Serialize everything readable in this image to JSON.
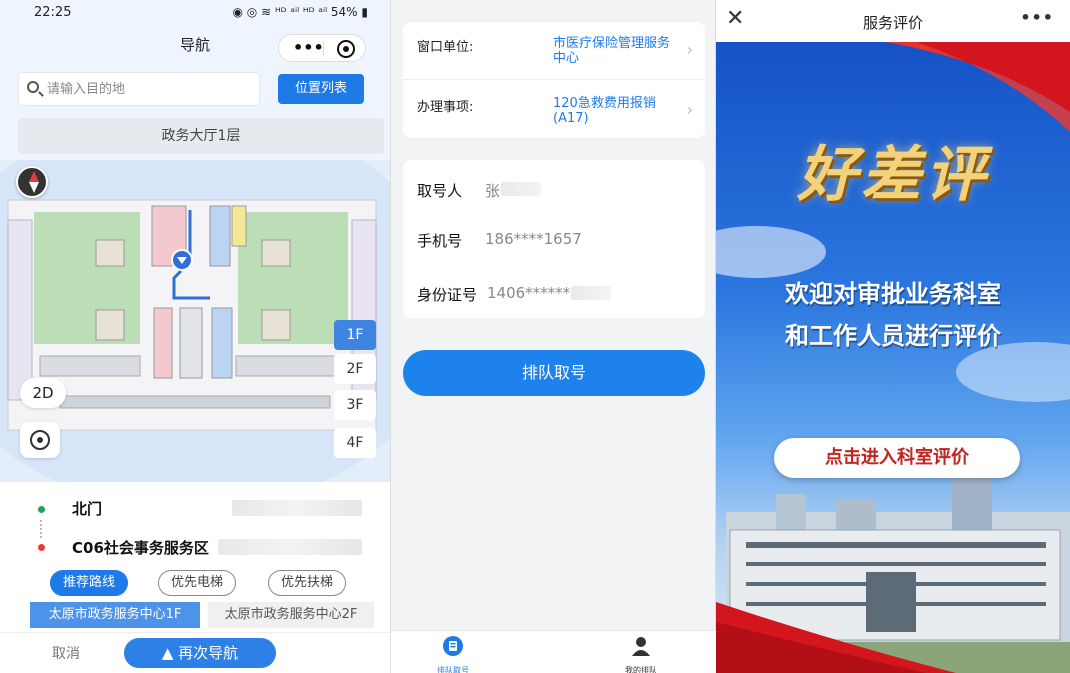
{
  "nav_panel": {
    "status": {
      "time": "22:25",
      "battery": "54%",
      "icons_text": "◉ ◎ ≋ ᴴᴰ ᵃⁱˡ ᴴᴰ ᵃⁱˡ"
    },
    "title": "导航",
    "search": {
      "placeholder": "请输入目的地"
    },
    "location_list_label": "位置列表",
    "floor_title": "政务大厅1层",
    "floors": [
      "1F",
      "2F",
      "3F",
      "4F"
    ],
    "active_floor": "1F",
    "mode_label": "2D",
    "route": {
      "start": "北门",
      "end": "C06社会事务服务区",
      "start_color": "#21a35b",
      "end_color": "#e43b3b"
    },
    "route_options": [
      "推荐路线",
      "优先电梯",
      "优先扶梯"
    ],
    "floor_tabs": [
      "太原市政务服务中心1F",
      "太原市政务服务中心2F"
    ],
    "cancel_label": "取消",
    "renavigate_label": "再次导航",
    "accent": "#1e7ae6"
  },
  "queue_panel": {
    "window_label": "窗口单位:",
    "window_value": "市医疗保险管理服务中心",
    "item_label": "办理事项:",
    "item_value": "120急救费用报销(A17)",
    "taker_label": "取号人",
    "taker_value": "张",
    "phone_label": "手机号",
    "phone_value": "186****1657",
    "id_label": "身份证号",
    "id_value": "1406******",
    "queue_button": "排队取号",
    "tabs": [
      {
        "label": "排队取号",
        "icon": "queue-ticket-icon",
        "active": true
      },
      {
        "label": "我的排队",
        "icon": "user-icon",
        "active": false
      }
    ]
  },
  "eval_panel": {
    "title": "服务评价",
    "close_icon": "close-icon",
    "more_icon": "more-icon",
    "poster_title": "好差评",
    "welcome_line1": "欢迎对审批业务科室",
    "welcome_line2": "和工作人员进行评价",
    "enter_button": "点击进入科室评价"
  }
}
